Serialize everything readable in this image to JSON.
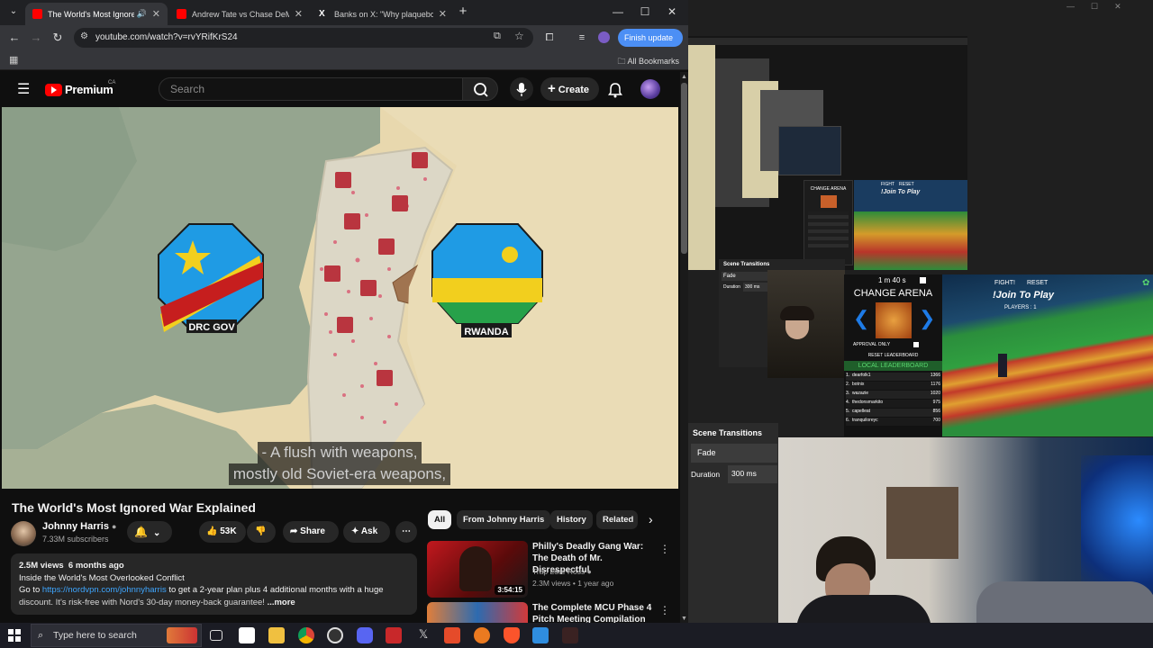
{
  "browser": {
    "tabs": [
      {
        "title": "The World's Most Ignored W",
        "active": true
      },
      {
        "title": "Andrew Tate vs Chase DeMoor",
        "active": false
      },
      {
        "title": "Banks on X: \"Why plaqueboym",
        "active": false
      }
    ],
    "new_tab": "+",
    "url": "youtube.com/watch?v=rvYRifKrS24",
    "finish_update": "Finish update",
    "all_bookmarks": "All Bookmarks"
  },
  "youtube": {
    "logo_text": "Premium",
    "region": "CA",
    "search_placeholder": "Search",
    "create_label": "Create",
    "map_labels": {
      "left": "DRC GOV",
      "right": "RWANDA"
    },
    "subtitle_lines": [
      "- A flush with weapons,",
      "mostly old Soviet-era weapons,"
    ],
    "video_title": "The World's Most Ignored War Explained",
    "channel_name": "Johnny Harris",
    "channel_subs": "7.33M subscribers",
    "like_count": "53K",
    "share_label": "Share",
    "ask_label": "Ask",
    "desc": {
      "views": "2.5M views",
      "age": "6 months ago",
      "line1": "Inside the World's Most Overlooked Conflict",
      "go_to": "Go to ",
      "link": "https://nordvpn.com/johnnyharris",
      "line2_rest": " to get a 2-year plan plus 4 additional months with a huge",
      "line3": "discount. It's risk-free with Nord's 30-day money-back guarantee!",
      "more": "...more"
    },
    "chips": [
      "All",
      "From Johnny Harris",
      "History",
      "Related"
    ],
    "recommendations": [
      {
        "title": "Philly's Deadly Gang War: The Death of Mr. Disrespectful",
        "channel": "Trap Lore Ross",
        "meta": "2.3M views • 1 year ago",
        "duration": "3:54:15"
      },
      {
        "title": "The Complete MCU Phase 4 Pitch Meeting Compilation",
        "channel": "",
        "meta": "",
        "duration": ""
      }
    ]
  },
  "obs": {
    "scene_transitions_title": "Scene Transitions",
    "transition_value": "Fade",
    "duration_label": "Duration",
    "duration_value": "300 ms",
    "game": {
      "timer": "1 m 40 s",
      "change_arena": "CHANGE ARENA",
      "approval_only": "APPROVAL ONLY",
      "reset_leaderboard": "RESET LEADERBOARD",
      "local_leaderboard": "LOCAL LEADERBOARD",
      "fight": "FIGHT!",
      "reset": "RESET",
      "join": "!Join To Play",
      "players": "PLAYERS : 1",
      "leaderboard": [
        {
          "rank": "1.",
          "name": "dearfolk1",
          "score": "1366"
        },
        {
          "rank": "2.",
          "name": "botnix",
          "score": "1176"
        },
        {
          "rank": "3.",
          "name": "wazazie",
          "score": "1020"
        },
        {
          "rank": "4.",
          "name": "thedonsmarkito",
          "score": "975"
        },
        {
          "rank": "5.",
          "name": "capelleat",
          "score": "856"
        },
        {
          "rank": "6.",
          "name": "tranquiloreyc",
          "score": "700"
        }
      ],
      "small_change_arena": "CHANGE ARENA",
      "small_join": "!Join To Play",
      "small_fight": "FIGHT",
      "small_reset": "RESET"
    }
  },
  "taskbar": {
    "search_placeholder": "Type here to search"
  }
}
